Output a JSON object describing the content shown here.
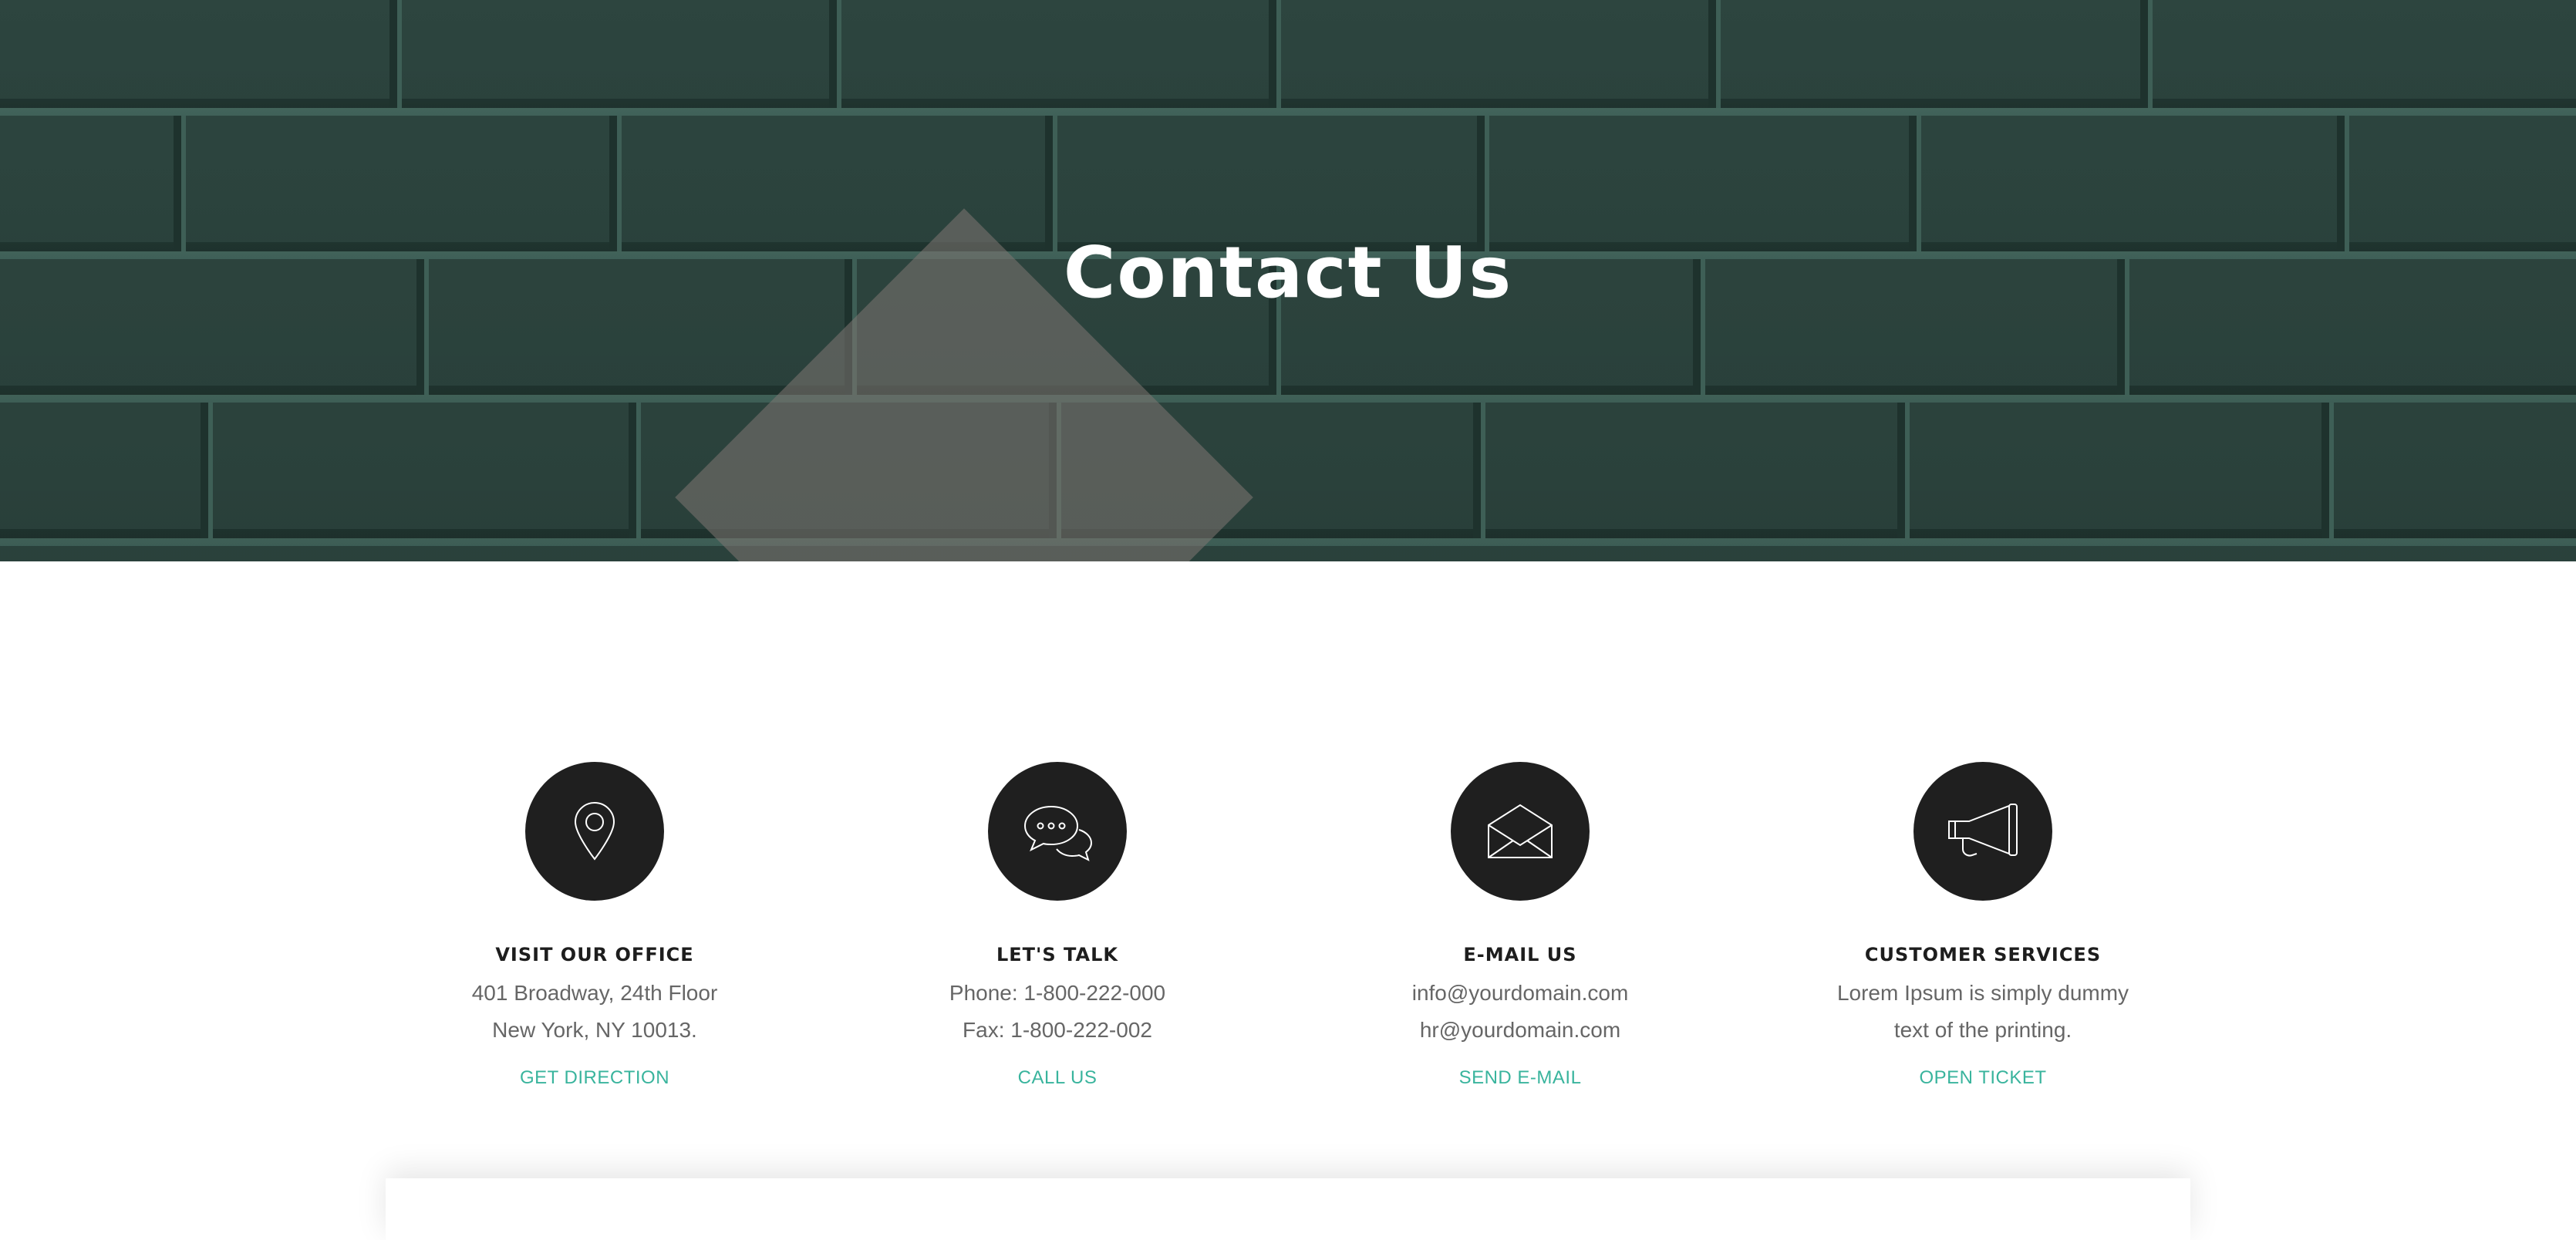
{
  "hero": {
    "title": "Contact Us"
  },
  "cards": [
    {
      "icon": "map-pin-icon",
      "title": "VISIT OUR OFFICE",
      "line1": "401 Broadway, 24th Floor",
      "line2": "New York, NY 10013.",
      "link": "GET DIRECTION"
    },
    {
      "icon": "chat-bubbles-icon",
      "title": "LET'S TALK",
      "line1": "Phone: 1-800-222-000",
      "line2": "Fax: 1-800-222-002",
      "link": "CALL US"
    },
    {
      "icon": "envelope-icon",
      "title": "E-MAIL US",
      "line1": "info@yourdomain.com",
      "line2": "hr@yourdomain.com",
      "link": "SEND E-MAIL"
    },
    {
      "icon": "megaphone-icon",
      "title": "CUSTOMER SERVICES",
      "line1": "Lorem Ipsum is simply dummy",
      "line2": "text of the printing.",
      "link": "OPEN TICKET"
    }
  ],
  "colors": {
    "hero_bg": "#2a413b",
    "accent": "#39b49d",
    "icon_bg": "#1f1f1f",
    "text": "#666666",
    "title": "#1d1d1d"
  }
}
